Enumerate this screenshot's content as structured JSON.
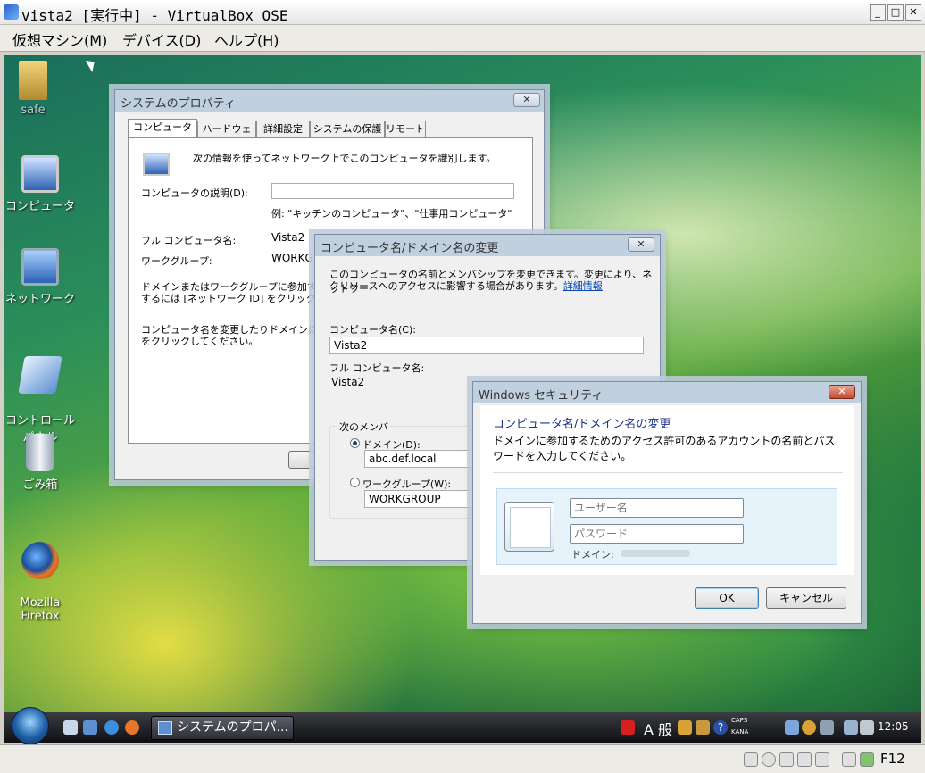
{
  "host": {
    "title": "vista2 [実行中] - VirtualBox OSE",
    "menu": [
      "仮想マシン(M)",
      "デバイス(D)",
      "ヘルプ(H)"
    ],
    "host_key": "F12"
  },
  "desktop": {
    "icons": [
      {
        "label": "safe"
      },
      {
        "label": "コンピュータ"
      },
      {
        "label": "ネットワーク"
      },
      {
        "label": "コントロール\nパネル"
      },
      {
        "label": "ごみ箱"
      },
      {
        "label": "Mozilla\nFirefox"
      }
    ]
  },
  "system_properties": {
    "title": "システムのプロパティ",
    "tabs": [
      "コンピュータ名",
      "ハードウェア",
      "詳細設定",
      "システムの保護",
      "リモート"
    ],
    "intro": "次の情報を使ってネットワーク上でこのコンピュータを識別します。",
    "description_label": "コンピュータの説明(D):",
    "description_value": "",
    "example": "例: \"キッチンのコンピュータ\"、\"仕事用コンピュータ\"",
    "full_name_label": "フル コンピュータ名:",
    "full_name_value": "Vista2",
    "workgroup_label": "ワークグループ:",
    "workgroup_value": "WORKGR",
    "domain_text_1": "ドメインまたはワークグループに参加するた",
    "domain_text_2": "するには [ネットワーク ID] をクリックしてくだ",
    "rename_text_1": "コンピュータ名を変更したりドメインに参加",
    "rename_text_2": "をクリックしてください。"
  },
  "computer_name_dialog": {
    "title": "コンピュータ名/ドメイン名の変更",
    "intro_1": "このコンピュータの名前とメンバシップを変更できます。変更により、ネットワー",
    "intro_2": "クリソースへのアクセスに影響する場合があります。",
    "more_info_link": "詳細情報",
    "name_label": "コンピュータ名(C):",
    "name_value": "Vista2",
    "full_name_label": "フル コンピュータ名:",
    "full_name_value": "Vista2",
    "member_of_label": "次のメンバ",
    "domain_label": "ドメイン(D):",
    "domain_value": "abc.def.local",
    "workgroup_label": "ワークグループ(W):",
    "workgroup_value": "WORKGROUP"
  },
  "security_dialog": {
    "title": "Windows セキュリティ",
    "heading": "コンピュータ名/ドメイン名の変更",
    "message_1": "ドメインに参加するためのアクセス許可のあるアカウントの名前とパス",
    "message_2": "ワードを入力してください。",
    "username_placeholder": "ユーザー名",
    "password_placeholder": "パスワード",
    "domain_label": "ドメイン:",
    "ok_label": "OK",
    "cancel_label": "キャンセル"
  },
  "taskbar": {
    "task_label": "システムのプロパ...",
    "ime_label": "A 般",
    "caps_label": "CAPS",
    "kana_label": "KANA",
    "clock": "12:05"
  }
}
